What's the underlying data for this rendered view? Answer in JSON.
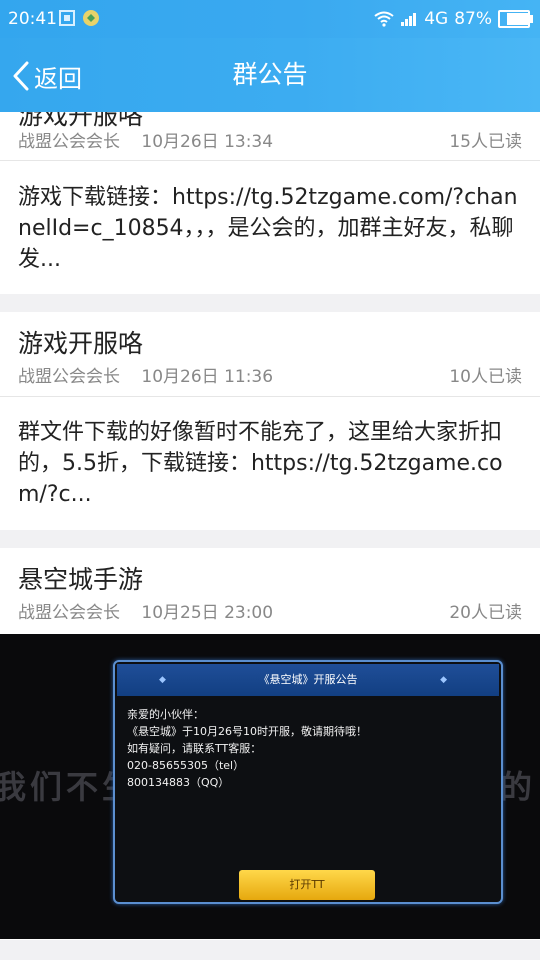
{
  "status_bar": {
    "time": "20:41",
    "network": "4G",
    "battery": "87%"
  },
  "nav": {
    "back_label": "返回",
    "title": "群公告"
  },
  "posts": [
    {
      "title": "游戏开服咯",
      "author": "战盟公会会长",
      "date": "10月26日 13:34",
      "reads": "15人已读",
      "body": "游戏下载链接：https://tg.52tzgame.com/?channelId=c_10854，，，是公会的，加群主好友，私聊发..."
    },
    {
      "title": "游戏开服咯",
      "author": "战盟公会会长",
      "date": "10月26日 11:36",
      "reads": "10人已读",
      "body": "群文件下载的好像暂时不能充了，这里给大家折扣的，5.5折，下载链接：https://tg.52tzgame.com/?c..."
    },
    {
      "title": "悬空城手游",
      "author": "战盟公会会长",
      "date": "10月25日 23:00",
      "reads": "20人已读"
    }
  ],
  "banner": {
    "bg_left": "我们不生",
    "bg_right": "的",
    "dialog_title": "《悬空城》开服公告",
    "greeting": "亲爱的小伙伴：",
    "line1": "《悬空城》于10月26号10时开服，敬请期待哦！",
    "line2": "如有疑问，请联系TT客服：",
    "line3": "020-85655305（tel）",
    "line4": "800134883（QQ）",
    "button": "打开TT"
  }
}
